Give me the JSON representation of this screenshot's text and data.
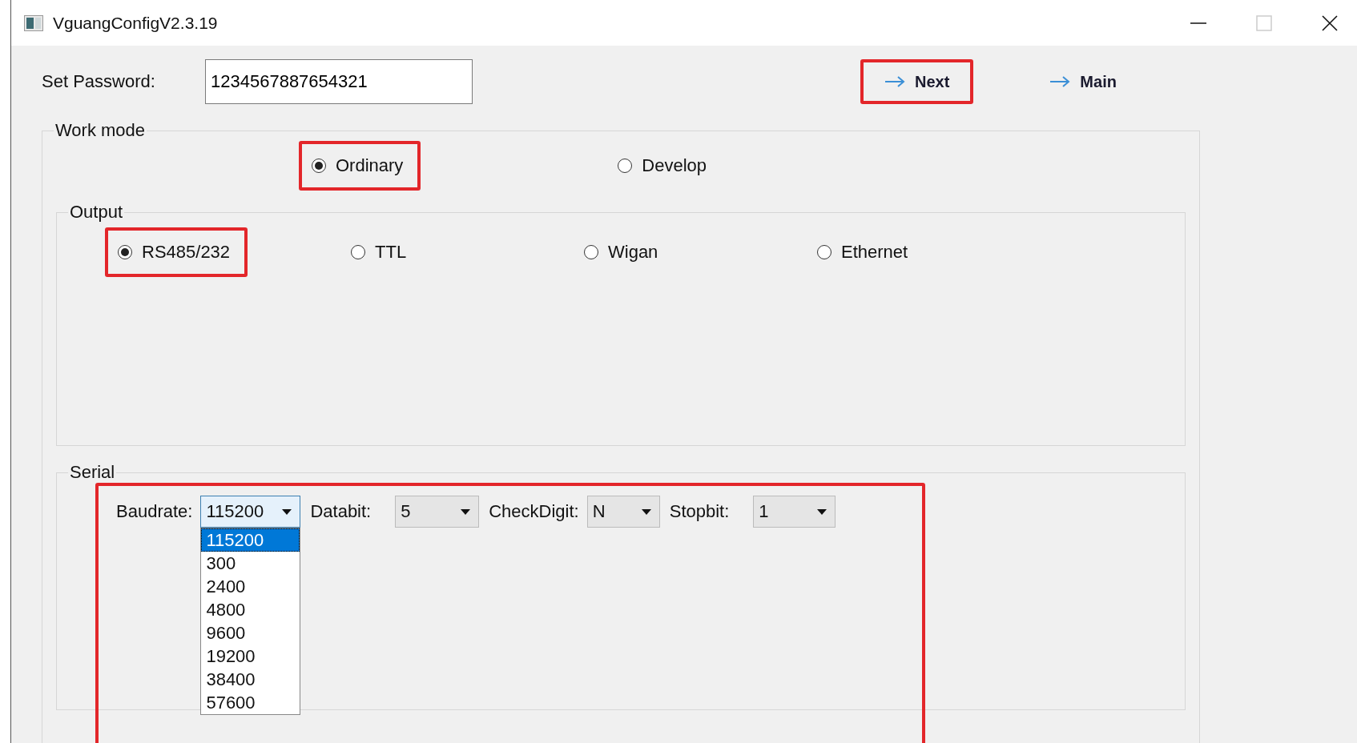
{
  "window": {
    "title": "VguangConfigV2.3.19"
  },
  "password": {
    "label": "Set Password:",
    "value": "1234567887654321"
  },
  "nav_buttons": [
    {
      "label": "Next",
      "highlighted": true
    },
    {
      "label": "Main",
      "highlighted": false
    }
  ],
  "work_mode": {
    "title": "Work mode",
    "options": [
      {
        "label": "Ordinary",
        "selected": true,
        "highlighted": true
      },
      {
        "label": "Develop",
        "selected": false,
        "highlighted": false
      }
    ]
  },
  "output": {
    "title": "Output",
    "options": [
      {
        "label": "RS485/232",
        "selected": true,
        "highlighted": true
      },
      {
        "label": "TTL",
        "selected": false,
        "highlighted": false
      },
      {
        "label": "Wigan",
        "selected": false,
        "highlighted": false
      },
      {
        "label": "Ethernet",
        "selected": false,
        "highlighted": false
      }
    ]
  },
  "serial": {
    "title": "Serial",
    "highlighted": true,
    "fields": [
      {
        "label": "Baudrate:",
        "value": "115200",
        "open": true,
        "options": [
          {
            "label": "115200",
            "selected": true
          },
          {
            "label": "300",
            "selected": false
          },
          {
            "label": "2400",
            "selected": false
          },
          {
            "label": "4800",
            "selected": false
          },
          {
            "label": "9600",
            "selected": false
          },
          {
            "label": "19200",
            "selected": false
          },
          {
            "label": "38400",
            "selected": false
          },
          {
            "label": "57600",
            "selected": false
          }
        ]
      },
      {
        "label": "Databit:",
        "value": "5",
        "open": false
      },
      {
        "label": "CheckDigit:",
        "value": "N",
        "open": false
      },
      {
        "label": "Stopbit:",
        "value": "1",
        "open": false
      }
    ]
  }
}
